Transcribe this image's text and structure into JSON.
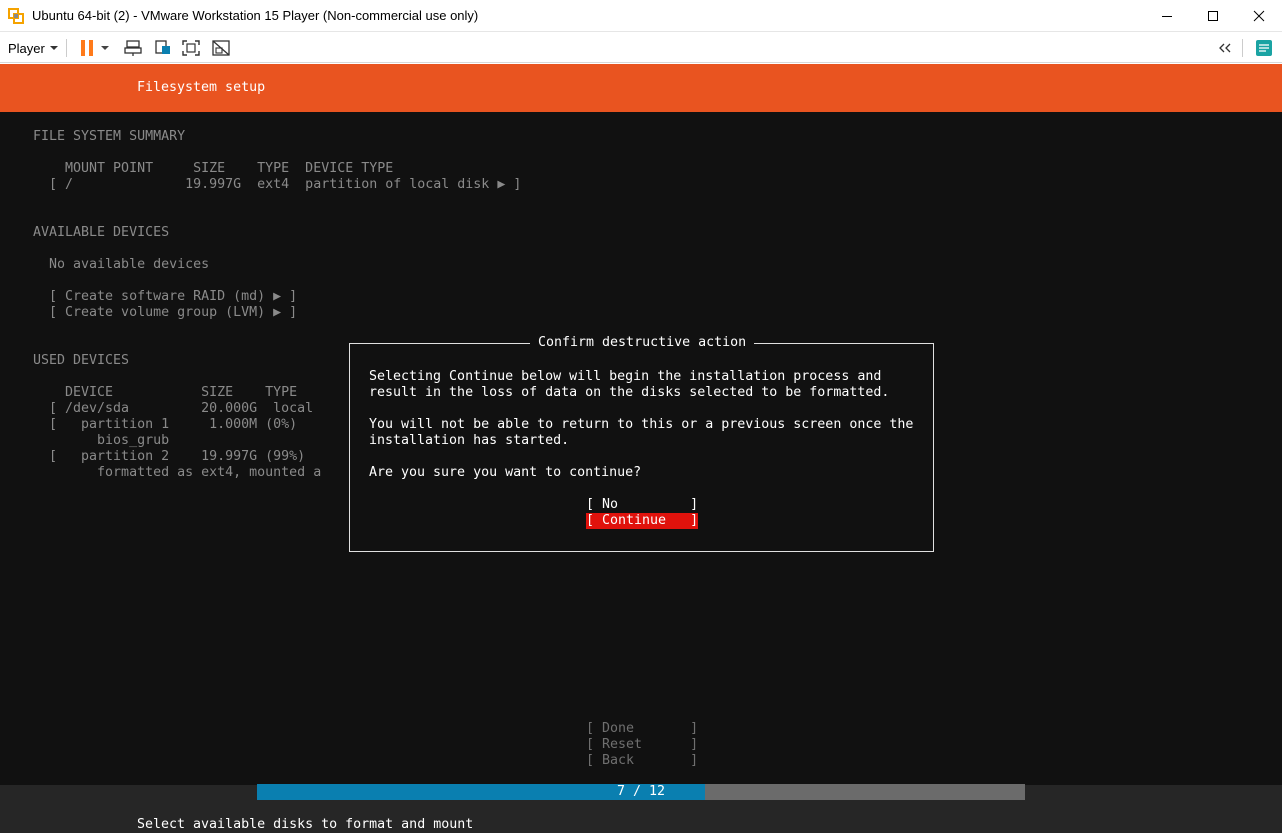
{
  "window": {
    "title": "Ubuntu 64-bit (2) - VMware Workstation 15 Player (Non-commercial use only)",
    "icon": "vmware-icon",
    "controls": [
      "minimize-icon",
      "maximize-icon",
      "close-icon"
    ]
  },
  "toolbar": {
    "player_label": "Player",
    "icons": [
      "pause-icon",
      "dropdown-caret-icon",
      "send-ctrl-alt-del-icon",
      "removable-devices-icon",
      "full-screen-icon",
      "unity-icon",
      "collapse-icon",
      "message-log-icon"
    ]
  },
  "installer": {
    "header_title": "Filesystem setup",
    "summary": {
      "heading": "FILE SYSTEM SUMMARY",
      "columns_line": "    MOUNT POINT     SIZE    TYPE  DEVICE TYPE",
      "rows": [
        "  [ /              19.997G  ext4  partition of local disk ▶ ]"
      ]
    },
    "available": {
      "heading": "AVAILABLE DEVICES",
      "empty_text": "  No available devices",
      "actions": [
        "  [ Create software RAID (md) ▶ ]",
        "  [ Create volume group (LVM) ▶ ]"
      ]
    },
    "used": {
      "heading": "USED DEVICES",
      "columns_line": "    DEVICE           SIZE    TYPE",
      "rows": [
        "  [ /dev/sda         20.000G  local",
        "  [   partition 1     1.000M (0%)",
        "        bios_grub",
        "  [   partition 2    19.997G (99%)",
        "        formatted as ext4, mounted a"
      ]
    },
    "dialog": {
      "title": "Confirm destructive action",
      "lines": [
        "Selecting Continue below will begin the installation process and",
        "result in the loss of data on the disks selected to be formatted.",
        "You will not be able to return to this or a previous screen once the",
        "installation has started.",
        "Are you sure you want to continue?"
      ],
      "no_label": "[ No         ]",
      "continue_label": "[ Continue   ]"
    },
    "footer_buttons": {
      "done": "[ Done       ]",
      "reset": "[ Reset      ]",
      "back": "[ Back       ]"
    },
    "progress": {
      "text": "7 / 12",
      "current": 7,
      "total": 12
    },
    "help_text": "Select available disks to format and mount"
  },
  "colors": {
    "ubuntu_orange": "#e95420",
    "selected_red": "#e0120c",
    "progress_blue": "#0a7fb0",
    "terminal_bg": "#111111"
  }
}
